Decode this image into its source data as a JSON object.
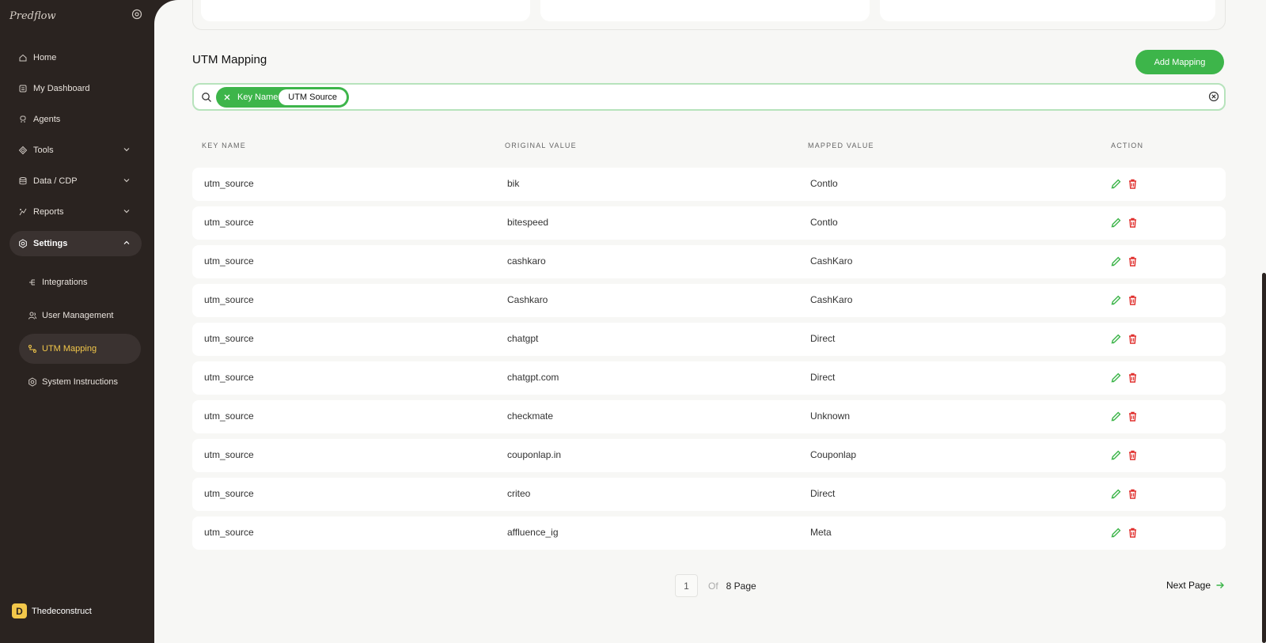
{
  "app": {
    "brand": "Predflow"
  },
  "sidebar": {
    "items": [
      {
        "label": "Home"
      },
      {
        "label": "My Dashboard"
      },
      {
        "label": "Agents"
      },
      {
        "label": "Tools"
      },
      {
        "label": "Data / CDP"
      },
      {
        "label": "Reports"
      },
      {
        "label": "Settings"
      }
    ],
    "settings_sub": [
      {
        "label": "Integrations"
      },
      {
        "label": "User Management"
      },
      {
        "label": "UTM Mapping"
      },
      {
        "label": "System Instructions"
      }
    ],
    "user": {
      "initial": "D",
      "name": "Thedeconstruct"
    }
  },
  "main": {
    "title": "UTM Mapping",
    "add_button": "Add Mapping",
    "filter": {
      "key": "Key Name",
      "value": "UTM Source"
    },
    "columns": [
      "KEY NAME",
      "ORIGINAL VALUE",
      "MAPPED VALUE",
      "ACTION"
    ],
    "rows": [
      {
        "key": "utm_source",
        "original": "bik",
        "mapped": "Contlo"
      },
      {
        "key": "utm_source",
        "original": "bitespeed",
        "mapped": "Contlo"
      },
      {
        "key": "utm_source",
        "original": "cashkaro",
        "mapped": "CashKaro"
      },
      {
        "key": "utm_source",
        "original": "Cashkaro",
        "mapped": "CashKaro"
      },
      {
        "key": "utm_source",
        "original": "chatgpt",
        "mapped": "Direct"
      },
      {
        "key": "utm_source",
        "original": "chatgpt.com",
        "mapped": "Direct"
      },
      {
        "key": "utm_source",
        "original": "checkmate",
        "mapped": "Unknown"
      },
      {
        "key": "utm_source",
        "original": "couponlap.in",
        "mapped": "Couponlap"
      },
      {
        "key": "utm_source",
        "original": "criteo",
        "mapped": "Direct"
      },
      {
        "key": "utm_source",
        "original": "affluence_ig",
        "mapped": "Meta"
      }
    ],
    "pagination": {
      "current": "1",
      "of": "Of",
      "total": "8 Page",
      "next": "Next Page"
    }
  },
  "colors": {
    "accent": "#3db54a",
    "delete": "#e0302e",
    "sidebar_bg": "#2a2320",
    "active_sub": "#f2c74a"
  }
}
